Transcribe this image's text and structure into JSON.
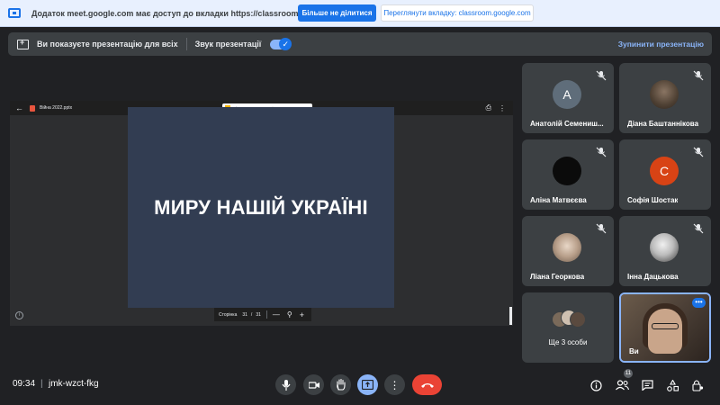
{
  "share_banner": {
    "message": "Додаток meet.google.com має доступ до вкладки https://classroom.google.com",
    "stop_sharing": "Більше не ділитися",
    "view_tab": "Переглянути вкладку: classroom.google.com"
  },
  "presenting_bar": {
    "message": "Ви показуєте презентацію для всіх",
    "sound_label": "Звук презентації",
    "sound_on": true,
    "stop_label": "Зупинити презентацію"
  },
  "presentation": {
    "file_name": "Війна 2022.pptx",
    "open_with": "Відкрити через Google Презен...",
    "slide_text": "МИРУ НАШІЙ УКРАЇНІ",
    "page_label": "Сторінка",
    "current_page": "31",
    "separator": "/",
    "total_pages": "31"
  },
  "participants": [
    {
      "name": "Анатолій Семениш...",
      "initial": "A",
      "avatar_color": "#5f6d7a",
      "muted": true
    },
    {
      "name": "Діана Баштаннікова",
      "initial": "",
      "avatar_color": "#6b5a4a",
      "muted": true
    },
    {
      "name": "Аліна Матвєєва",
      "initial": "",
      "avatar_color": "#111111",
      "muted": true
    },
    {
      "name": "Софія Шостак",
      "initial": "С",
      "avatar_color": "#d84315",
      "muted": true
    },
    {
      "name": "Ліана Георкова",
      "initial": "",
      "avatar_color": "#cfc4bb",
      "muted": true
    },
    {
      "name": "Інна Дацькова",
      "initial": "",
      "avatar_color": "#e6e6e6",
      "muted": true
    }
  ],
  "more_people": "Ще 3 особи",
  "self_tile": {
    "name": "Ви"
  },
  "bottom_bar": {
    "time": "09:34",
    "separator": "|",
    "meeting_code": "jmk-wzct-fkg",
    "participant_count": "11"
  }
}
